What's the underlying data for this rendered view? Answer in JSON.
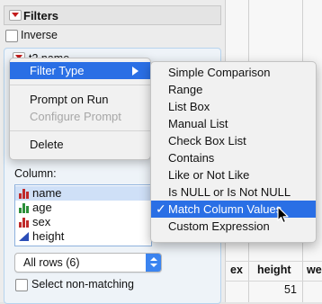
{
  "filters_panel": {
    "title": "Filters",
    "inverse_label": "Inverse",
    "filter_name": "t2 name",
    "column_label": "Column:",
    "columns": [
      {
        "name": "name",
        "icon": "bar-chart-red-icon"
      },
      {
        "name": "age",
        "icon": "bar-chart-green-icon"
      },
      {
        "name": "sex",
        "icon": "bar-chart-red-icon"
      },
      {
        "name": "height",
        "icon": "continuous-blue-triangle-icon"
      }
    ],
    "rows_select": "All rows (6)",
    "select_non_matching_label": "Select non-matching"
  },
  "context_menu": {
    "items": [
      "Filter Type",
      "Prompt on Run",
      "Configure Prompt",
      "Delete"
    ]
  },
  "filter_type_menu": {
    "items": [
      "Simple Comparison",
      "Range",
      "List Box",
      "Manual List",
      "Check Box List",
      "Contains",
      "Like or Not Like",
      "Is NULL or Is Not NULL",
      "Match Column Values",
      "Custom Expression"
    ],
    "checked": "Match Column Values",
    "check_glyph": "✓"
  },
  "data_table": {
    "headers": [
      "ex",
      "height",
      "we"
    ],
    "first_value": "51"
  },
  "colors": {
    "accent": "#2a6fe5",
    "disclosure_red": "#c41d1d"
  }
}
